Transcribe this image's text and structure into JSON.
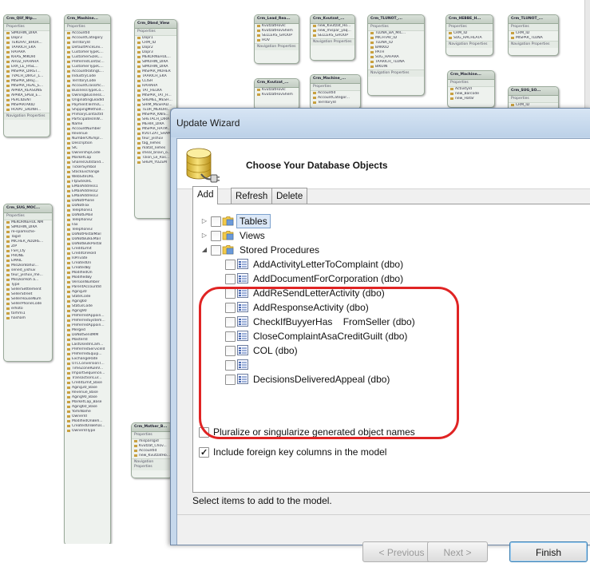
{
  "diagram": {
    "entities": [
      {
        "title": "Crm_Qlif_Ntp...",
        "section": "Properties",
        "rows": [
          "SIMUHIN_DIRA",
          "Dopr3",
          "TEKUFAT_BHUR...",
          "TAARICH_EKA",
          "HAFARA",
          "KHAS_MIKORI",
          "AHUZ_HAHAHA",
          "ERA_LE_FASL...",
          "MISPAR_DIRGT...",
          "TVACH_DIRGT_L...",
          "MISPAR_BHEJ...",
          "MISPAR_HEAL_E...",
          "APAKA_REASONS",
          "APAKA_SPEB_E...",
          "PERCIDENT",
          "MISPARTAKID",
          "HOVAT_EKUNH..."
        ],
        "nav": "Navigation Properties"
      },
      {
        "title": "Crm_Mashine...",
        "section": "Properties",
        "rows": [
          "AccountId",
          "AccountCategory",
          "Territoryld",
          "DefaultPriceLev...",
          "CustomerTypeC...",
          "CustomerSizeC...",
          "PreferredContac...",
          "CustomerTypeC...",
          "AccountRatingC...",
          "IndustryCode",
          "TerritoryCode",
          "AccountClassific...",
          "BusinessTypeCo...",
          "OwningBusiness...",
          "OriginatingLeadId",
          "PaymentTermsC...",
          "ShippingMethod...",
          "PrimaryContactId",
          "ParticipatesInW...",
          "Name",
          "AccountNumber",
          "Revenue",
          "NumberOfEmpl...",
          "Description",
          "SIC",
          "OwnershipCode",
          "MarketCap",
          "SharesOutstand...",
          "TickerSymbol",
          "StockExchange",
          "WebSiteURL",
          "FtpSiteURL",
          "EMailAddress1",
          "EMailAddress2",
          "EMailAddress3",
          "DoNotPhone",
          "DoNotFax",
          "Telephone1",
          "DoNotEMail",
          "Telephone2",
          "Fax",
          "Telephone3",
          "DoNotPostalMail",
          "DoNotBulkEMail",
          "DoNotBulkPostal",
          "CreditLimit",
          "CreditOnHold",
          "IsPrivate",
          "CreatedOn",
          "CreatedBy",
          "ModifiedOn",
          "ModifiedBy",
          "VersionNumber",
          "ParentAccountId",
          "Aging30",
          "StateCode",
          "Aging60",
          "StatusCode",
          "Aging90",
          "PreferredAppoin...",
          "PreferredSystem...",
          "PreferredAppoin...",
          "Merged",
          "DoNotSendMM",
          "MasterId",
          "LastUsedInCam...",
          "PreferredServiceId",
          "PreferredEquip...",
          "ExchangeRate",
          "UTCConversionT...",
          "TimeZoneRuleV...",
          "ImportSequence...",
          "TransactionCur...",
          "CreditLimit_Base",
          "Aging30_Base",
          "Revenue_Base",
          "Aging90_Base",
          "MarketCap_Base",
          "Aging60_Base",
          "YomiName",
          "OwnerId",
          "ModifiedOnBeh...",
          "CreatedOnBehal...",
          "OwnerIdType"
        ],
        "nav": ""
      },
      {
        "title": "Crm_Dbnd_View",
        "section": "Properties",
        "rows": [
          "Dopr1",
          "CRM_ID",
          "Dopr2",
          "Dopr3",
          "MEKORNEHUL...",
          "SIMUHIN_DIRA",
          "SIMUHIN_DIRA",
          "MISPAR_MOHER",
          "TAARICH_EKA",
          "CLISH",
          "HAHAHA",
          "TAT_HELKA",
          "MISPAR_TAT_H...",
          "SHEMEL_MESH...",
          "SHIM_MESHAD...",
          "TEUR_MEKORI...",
          "MISPAR_KNIS...",
          "SHETACH_DIRA",
          "MEHIR_DIRA",
          "MISPAR_HATM...",
          "KVUTZAT_SHAM...",
          "teur_yishuv",
          "tag_nehes",
          "matat_nehes",
          "sheal_bnain_o...",
          "Tzion_Le_Ras...",
          "SHEM_YOZEM"
        ],
        "nav": ""
      },
      {
        "title": "Crm_Lead_Rea...",
        "section": "",
        "rows": [
          "KvutzatHovIc",
          "KvutzatHovShem",
          "SELLERS_GROUP",
          "HOV"
        ],
        "nav": "Navigation Properties"
      },
      {
        "title": "Crm_Kvutzat_...",
        "section": "",
        "rows": [
          "new_Kvutzat_Ho...",
          "new_mispar_yaq...",
          "SELLERS_GROUP"
        ],
        "nav": "Navigation Properties"
      },
      {
        "title": "Crm_TLUNOT_...",
        "section": "Properties",
        "rows": [
          "TLUNA_BA_MIC...",
          "MICHTAV_ID",
          "TLUNA_ID",
          "BAKKID",
          "PATH",
          "SUG_HAFARA",
          "TAARICH_TLUNA",
          "BIKUIN"
        ],
        "nav": "Navigation Properties"
      },
      {
        "title": "Crm_HEBBE_H...",
        "section": "Properties",
        "rows": [
          "CRM_ID",
          "SUG_HACHLATA"
        ],
        "nav": "Navigation Properties"
      },
      {
        "title": "Crm_TLUNOT_...",
        "section": "Properties",
        "rows": [
          "CRM_ID",
          "MISPAR_TLUNA"
        ],
        "nav": "Navigation Properties"
      },
      {
        "title": "Crm_Kvutzat_...",
        "section": "",
        "rows": [
          "KvutzatHovIc",
          "KvutzatHovShem"
        ],
        "nav": ""
      },
      {
        "title": "Crm_Machine_...",
        "section": "Properties",
        "rows": [
          "AccountId",
          "AccountCategor...",
          "Territoryld"
        ],
        "nav": ""
      },
      {
        "title": "Crm_Machine...",
        "section": "Properties",
        "rows": [
          "Activityld",
          "new_Barcode",
          "new_Hafar"
        ],
        "nav": ""
      },
      {
        "title": "Crm_SUG_SO...",
        "section": "Properties",
        "rows": [
          "CRM_ID",
          "SUG_SOREM"
        ],
        "nav": ""
      },
      {
        "title": "Crm_SUG_MOC...",
        "section": "Properties",
        "rows": [
          "MEKORNEHUL NM",
          "SIMUHIN_DIRA",
          "re-spamsche-",
          "Tagid",
          "MICHER_ADDRE...",
          "ZIP",
          "FSH_Lfy",
          "PHONE",
          "EMAIL",
          "MisDiorBahul...",
          "sened_yishuv",
          "teur_yishuv_me...",
          "MisDiorHoh a...",
          "Type",
          "SellerSettlement",
          "SellerStreet",
          "SellerHouseNum",
          "SellerPhoneCode",
          "erhoto",
          "torhmi1",
          "hasham"
        ],
        "nav": ""
      },
      {
        "title": "Crm_Mother_B...",
        "section": "Properties",
        "rows": [
          "misparsgid",
          "Kvutzat_Chov...",
          "AccountId",
          "new_KvutzatHo..."
        ],
        "nav": "Navigation Properties"
      }
    ]
  },
  "wizard": {
    "title": "Update Wizard",
    "header_title": "Choose Your Database Objects",
    "tabs": [
      "Add",
      "Refresh",
      "Delete"
    ],
    "tree": {
      "tables_label": "Tables",
      "views_label": "Views",
      "stored_procedures_label": "Stored Procedures",
      "procedures": [
        "AddActivityLetterToComplaint (dbo)",
        "AddDocumentForCorporation (dbo)",
        "AddReSendLetterActivity (dbo)",
        "AddResponseActivity (dbo)",
        "CheckIfBuyyerHas    FromSeller (dbo)",
        "CloseComplaintAsaCreditGuilt (dbo)",
        "COL (dbo)",
        "",
        "DecisionsDeliveredAppeal (dbo)"
      ]
    },
    "options": {
      "pluralize_label": "Pluralize or singularize generated object names",
      "pluralize_checked": false,
      "foreign_key_label": "Include foreign key columns in the model",
      "foreign_key_checked": true
    },
    "status_text": "Select items to add to the model.",
    "buttons": {
      "previous": "< Previous",
      "next": "Next >",
      "finish": "Finish"
    },
    "highlight_color": "#e02424"
  }
}
